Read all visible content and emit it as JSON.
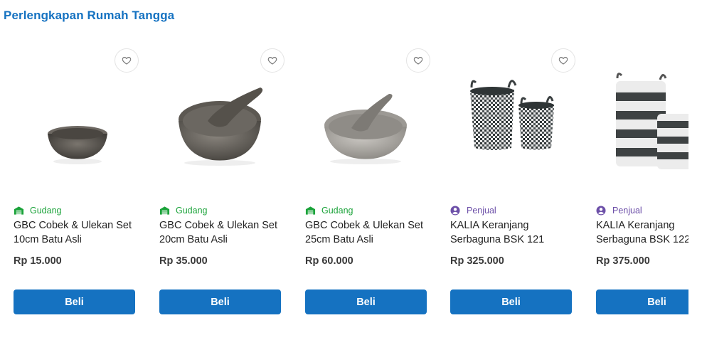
{
  "section": {
    "title": "Perlengkapan Rumah Tangga"
  },
  "colors": {
    "accent": "#1572c1",
    "gudang": "#1ba33a",
    "penjual": "#6c4fa8"
  },
  "products": [
    {
      "source": "Gudang",
      "source_icon": "warehouse-icon",
      "name": "GBC Cobek & Ulekan Set 10cm Batu Asli",
      "price": "Rp 15.000",
      "buy_label": "Beli",
      "image": "small-stone-mortar"
    },
    {
      "source": "Gudang",
      "source_icon": "warehouse-icon",
      "name": "GBC Cobek & Ulekan Set 20cm Batu Asli",
      "price": "Rp 35.000",
      "buy_label": "Beli",
      "image": "stone-mortar-with-pestle"
    },
    {
      "source": "Gudang",
      "source_icon": "warehouse-icon",
      "name": "GBC Cobek & Ulekan Set 25cm Batu Asli",
      "price": "Rp 60.000",
      "buy_label": "Beli",
      "image": "grey-stone-mortar-with-pestle"
    },
    {
      "source": "Penjual",
      "source_icon": "seller-icon",
      "name": "KALIA Keranjang Serbaguna BSK 121",
      "price": "Rp 325.000",
      "buy_label": "Beli",
      "image": "knitted-baskets-pair"
    },
    {
      "source": "Penjual",
      "source_icon": "seller-icon",
      "name": "KALIA Keranjang Serbaguna BSK 122",
      "price": "Rp 375.000",
      "buy_label": "Beli",
      "image": "striped-baskets-pair"
    }
  ]
}
